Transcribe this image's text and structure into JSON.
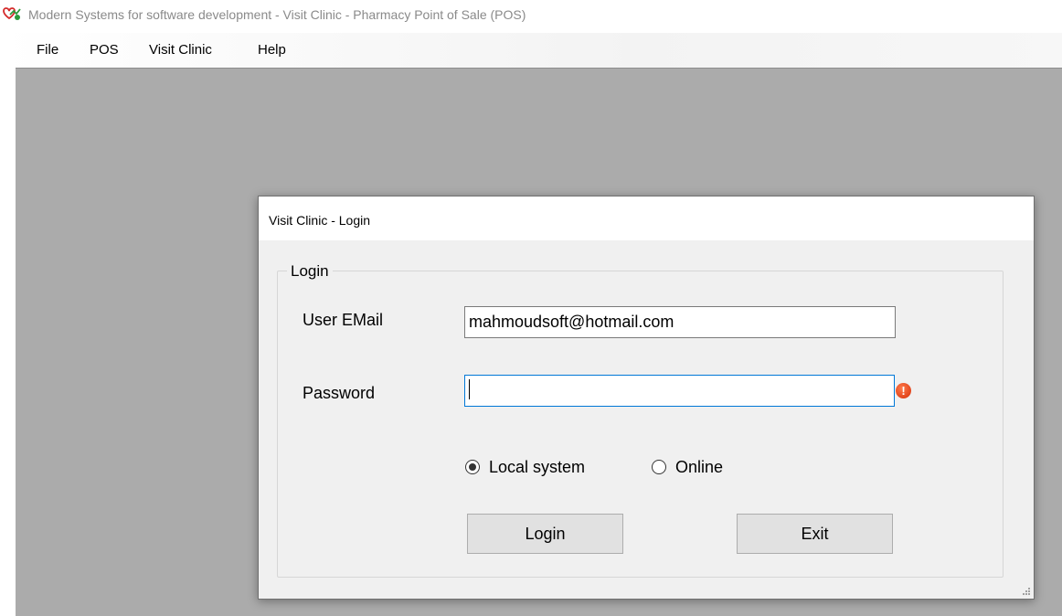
{
  "window": {
    "title": "Modern Systems for software development - Visit Clinic - Pharmacy Point of Sale (POS)",
    "icon": "app-logo-icon"
  },
  "menu": {
    "items": [
      {
        "label": "File"
      },
      {
        "label": "POS"
      },
      {
        "label": "Visit Clinic"
      },
      {
        "label": "Help"
      }
    ]
  },
  "dialog": {
    "title": "Visit Clinic - Login",
    "group_title": "Login",
    "email": {
      "label": "User EMail",
      "value": "mahmoudsoft@hotmail.com"
    },
    "password": {
      "label": "Password",
      "value": "",
      "error_icon": "error-icon"
    },
    "mode": {
      "options": [
        {
          "label": "Local system",
          "selected": true
        },
        {
          "label": "Online",
          "selected": false
        }
      ]
    },
    "buttons": {
      "login": "Login",
      "exit": "Exit"
    }
  },
  "colors": {
    "mdi_background": "#ababab",
    "dialog_background": "#f0f0f0",
    "focus_border": "#0078d7",
    "error_icon": "#e2401a"
  }
}
